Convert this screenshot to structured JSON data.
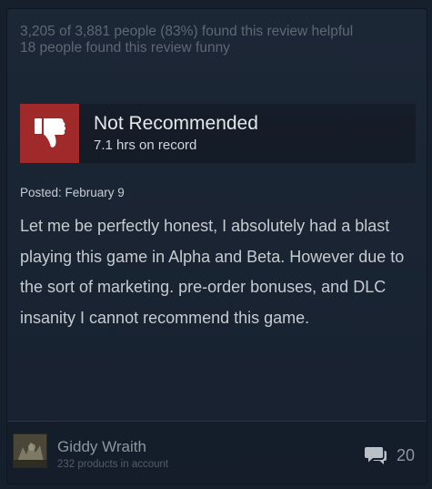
{
  "review": {
    "helpful_text": "3,205 of 3,881 people (83%) found this review helpful",
    "funny_text": "18 people found this review funny",
    "recommendation": "Not Recommended",
    "hours": "7.1 hrs on record",
    "posted": "Posted: February 9",
    "body": "Let me be perfectly honest, I absolutely had a blast playing this game in Alpha and Beta. However due to the sort of marketing. pre-order bonuses, and DLC insanity I cannot recommend this game."
  },
  "author": {
    "name": "Giddy Wraith",
    "products": "232 products in account"
  },
  "comments": {
    "count": "20"
  },
  "icons": {
    "thumb": "thumbs-down-icon",
    "comment": "comment-bubble-icon"
  },
  "colors": {
    "thumb_background": "#a02a2a",
    "card_background": "#1c2736",
    "page_background": "#16202d"
  }
}
